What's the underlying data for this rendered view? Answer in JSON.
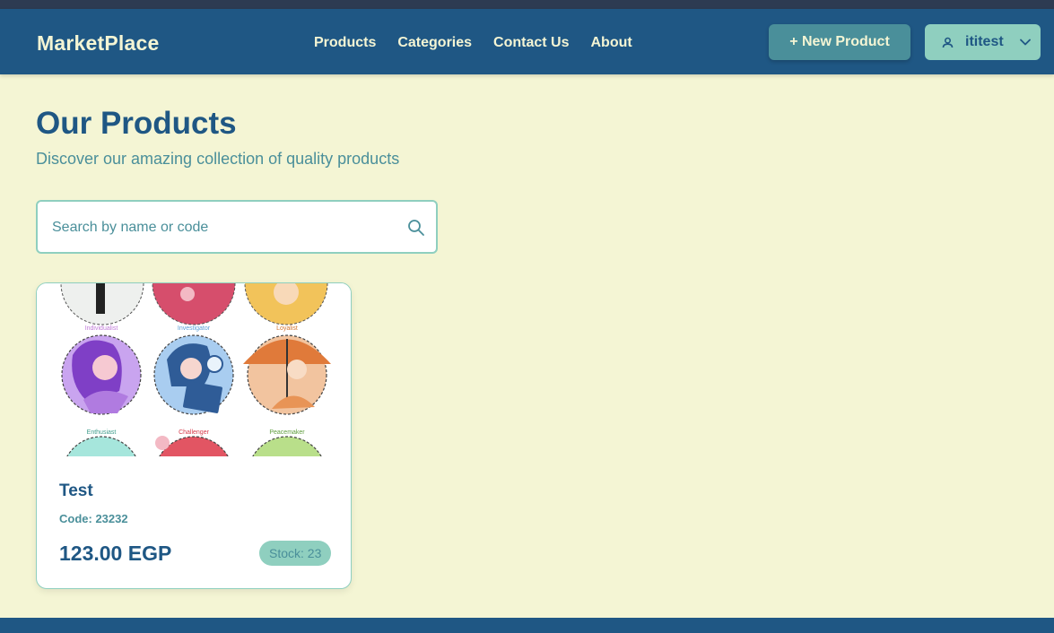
{
  "colors": {
    "navbar": "#1f5784",
    "background": "#f4f5d4",
    "accent": "#4a8f9a",
    "mint": "#8fcfbf",
    "primary_text": "#1f5784"
  },
  "navbar": {
    "brand": "MarketPlace",
    "links": [
      "Products",
      "Categories",
      "Contact Us",
      "About"
    ],
    "new_product_label": "+ New Product",
    "user_name": "ititest",
    "user_icon": "user-icon",
    "dropdown_icon": "chevron-down-icon"
  },
  "page": {
    "title": "Our Products",
    "subtitle": "Discover our amazing collection of quality products"
  },
  "search": {
    "placeholder": "Search by name or code",
    "value": "",
    "icon": "search-icon"
  },
  "products": [
    {
      "name": "Test",
      "code": "Code: 23232",
      "price": "123.00 EGP",
      "stock": "Stock: 23",
      "image_labels": [
        "Individualist",
        "Investigator",
        "Loyalist",
        "Enthusiast",
        "Challenger",
        "Peacemaker"
      ]
    }
  ]
}
